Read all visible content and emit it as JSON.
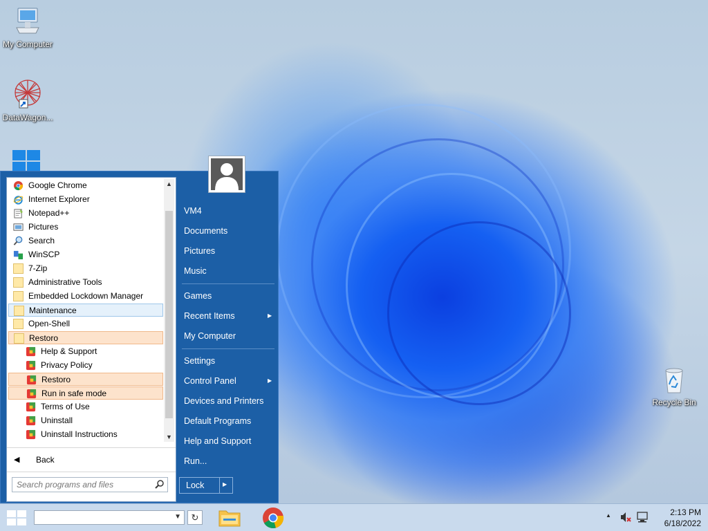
{
  "desktop": {
    "icons": [
      {
        "label": "My Computer"
      },
      {
        "label": "DataWagon..."
      },
      {
        "label": "Recycle Bin"
      }
    ]
  },
  "start_menu": {
    "programs": [
      {
        "label": "Google Chrome"
      },
      {
        "label": "Internet Explorer"
      },
      {
        "label": "Notepad++"
      },
      {
        "label": "Pictures"
      },
      {
        "label": "Search"
      },
      {
        "label": "WinSCP"
      },
      {
        "label": "7-Zip"
      },
      {
        "label": "Administrative Tools"
      },
      {
        "label": "Embedded Lockdown Manager"
      },
      {
        "label": "Maintenance"
      },
      {
        "label": "Open-Shell"
      },
      {
        "label": "Restoro"
      },
      {
        "label": "Help & Support"
      },
      {
        "label": "Privacy Policy"
      },
      {
        "label": "Restoro"
      },
      {
        "label": "Run in safe mode"
      },
      {
        "label": "Terms of Use"
      },
      {
        "label": "Uninstall"
      },
      {
        "label": "Uninstall Instructions"
      }
    ],
    "back_label": "Back",
    "search_placeholder": "Search programs and files",
    "right_items": [
      {
        "label": "VM4"
      },
      {
        "label": "Documents"
      },
      {
        "label": "Pictures"
      },
      {
        "label": "Music"
      },
      {
        "label": "Games"
      },
      {
        "label": "Recent Items"
      },
      {
        "label": "My Computer"
      },
      {
        "label": "Settings"
      },
      {
        "label": "Control Panel"
      },
      {
        "label": "Devices and Printers"
      },
      {
        "label": "Default Programs"
      },
      {
        "label": "Help and Support"
      },
      {
        "label": "Run..."
      }
    ],
    "lock_label": "Lock"
  },
  "taskbar": {
    "clock_time": "2:13 PM",
    "clock_date": "6/18/2022"
  },
  "colors": {
    "menu_blue": "#1c5fa6",
    "highlight_orange": "#fde3cc",
    "highlight_blue": "#e5f1fb",
    "taskbar": "#c9daed"
  }
}
